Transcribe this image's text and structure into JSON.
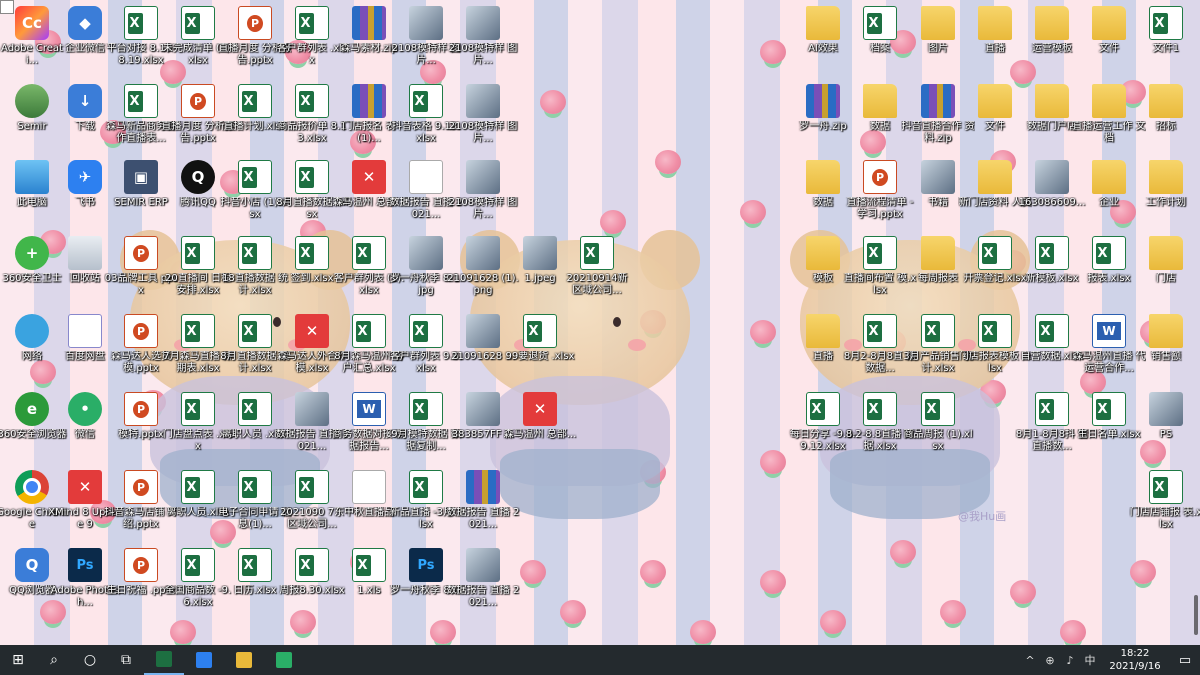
{
  "desktop": {
    "watermark": "@我Hu画",
    "icons": [
      {
        "label": "Adobe Creati...",
        "type": "adobe",
        "glyph": "Cc",
        "col": 0,
        "row": 0
      },
      {
        "label": "Semir",
        "type": "user",
        "glyph": "",
        "col": 0,
        "row": 1
      },
      {
        "label": "此电脑",
        "type": "pc",
        "glyph": "",
        "col": 0,
        "row": 2
      },
      {
        "label": "360安全卫士",
        "type": "360",
        "glyph": "+",
        "col": 0,
        "row": 3
      },
      {
        "label": "网络",
        "type": "net",
        "glyph": "",
        "col": 0,
        "row": 4
      },
      {
        "label": "360安全浏览器",
        "type": "ie",
        "glyph": "e",
        "col": 0,
        "row": 5
      },
      {
        "label": "Google Chrome",
        "type": "chrome",
        "glyph": "",
        "col": 0,
        "row": 6
      },
      {
        "label": "QQ浏览器",
        "type": "app",
        "glyph": "Q",
        "col": 0,
        "row": 7
      },
      {
        "label": "企业微信",
        "type": "app",
        "glyph": "◆",
        "col": 1,
        "row": 0
      },
      {
        "label": "下载",
        "type": "app",
        "glyph": "↓",
        "col": 1,
        "row": 1
      },
      {
        "label": "飞书",
        "type": "feishu",
        "glyph": "✈",
        "col": 1,
        "row": 2
      },
      {
        "label": "回收站",
        "type": "bin",
        "glyph": "",
        "col": 1,
        "row": 3
      },
      {
        "label": "百度网盘",
        "type": "cloud",
        "glyph": "☁",
        "col": 1,
        "row": 4
      },
      {
        "label": "微信",
        "type": "wechat",
        "glyph": "•",
        "col": 1,
        "row": 5
      },
      {
        "label": "XMind 8 Update 9",
        "type": "xmind",
        "glyph": "✕",
        "col": 1,
        "row": 6
      },
      {
        "label": "Adobe Photosh...",
        "type": "ps",
        "glyph": "Ps",
        "col": 1,
        "row": 7
      },
      {
        "label": "平台对接 8.13-8.19.xlsx",
        "type": "excel",
        "glyph": "X",
        "col": 2,
        "row": 0
      },
      {
        "label": "森马新品商务合作直播表...",
        "type": "excel",
        "glyph": "X",
        "col": 2,
        "row": 1
      },
      {
        "label": "SEMIR ERP",
        "type": "erp",
        "glyph": "▣",
        "col": 2,
        "row": 2
      },
      {
        "label": "03品牌工具 pptx",
        "type": "ppt",
        "glyph": "P",
        "col": 2,
        "row": 3
      },
      {
        "label": "森马达人选货 模.pptx",
        "type": "ppt",
        "glyph": "P",
        "col": 2,
        "row": 4
      },
      {
        "label": "模特.pptx",
        "type": "ppt",
        "glyph": "P",
        "col": 2,
        "row": 5
      },
      {
        "label": "抖音森马店铺 介绍.pptx",
        "type": "ppt",
        "glyph": "P",
        "col": 2,
        "row": 6
      },
      {
        "label": "生日祝福 .pptx",
        "type": "ppt",
        "glyph": "P",
        "col": 2,
        "row": 7
      },
      {
        "label": "未完成清单 (1).xlsx",
        "type": "excel",
        "glyph": "X",
        "col": 3,
        "row": 0
      },
      {
        "label": "直播月度 分析报告.pptx",
        "type": "ppt",
        "glyph": "P",
        "col": 3,
        "row": 1
      },
      {
        "label": "腾讯QQ",
        "type": "qq",
        "glyph": "Q",
        "col": 3,
        "row": 2
      },
      {
        "label": "20直播间 日程安排.xlsx",
        "type": "excel",
        "glyph": "X",
        "col": 3,
        "row": 3
      },
      {
        "label": "7月森马直播 排期表.xlsx",
        "type": "excel",
        "glyph": "X",
        "col": 3,
        "row": 4
      },
      {
        "label": "门店盘点表 .xlsx",
        "type": "excel",
        "glyph": "X",
        "col": 3,
        "row": 5
      },
      {
        "label": "离职人员.xlsx",
        "type": "excel",
        "glyph": "X",
        "col": 3,
        "row": 6
      },
      {
        "label": "全国商品数 -9.6.xlsx",
        "type": "excel",
        "glyph": "X",
        "col": 3,
        "row": 7
      },
      {
        "label": "直播月度 分析报告.pptx",
        "type": "ppt",
        "glyph": "P",
        "col": 4,
        "row": 0
      },
      {
        "label": "直播计划.xlsx",
        "type": "excel",
        "glyph": "X",
        "col": 4,
        "row": 1
      },
      {
        "label": "抖音小店 (1).xlsx",
        "type": "excel",
        "glyph": "X",
        "col": 4,
        "row": 2
      },
      {
        "label": "18直播数据 统计.xlsx",
        "type": "excel",
        "glyph": "X",
        "col": 4,
        "row": 3
      },
      {
        "label": "8月直播数据 统计.xlsx",
        "type": "excel",
        "glyph": "X",
        "col": 4,
        "row": 4
      },
      {
        "label": "离职人员 .xlsx",
        "type": "excel",
        "glyph": "X",
        "col": 4,
        "row": 5
      },
      {
        "label": "电子合同申请 信息(1)...",
        "type": "excel",
        "glyph": "X",
        "col": 4,
        "row": 6
      },
      {
        "label": "日历.xlsx",
        "type": "excel",
        "glyph": "X",
        "col": 4,
        "row": 7
      },
      {
        "label": "客户群列表 .xlsx",
        "type": "excel",
        "glyph": "X",
        "col": 5,
        "row": 0
      },
      {
        "label": "商品报价单 8.13.xlsx",
        "type": "excel",
        "glyph": "X",
        "col": 5,
        "row": 1
      },
      {
        "label": "8月直播数据 .xlsx",
        "type": "excel",
        "glyph": "X",
        "col": 5,
        "row": 2
      },
      {
        "label": "签到.xlsx",
        "type": "excel",
        "glyph": "X",
        "col": 5,
        "row": 3
      },
      {
        "label": "森马达人外合作 模.xlsx",
        "type": "xmind",
        "glyph": "✕",
        "col": 5,
        "row": 4
      },
      {
        "label": "数据报告 直播 2021...",
        "type": "img",
        "glyph": "",
        "col": 5,
        "row": 5
      },
      {
        "label": "2021090 7东 区域公司...",
        "type": "excel",
        "glyph": "X",
        "col": 5,
        "row": 6
      },
      {
        "label": "周报8.30.xlsx",
        "type": "excel",
        "glyph": "X",
        "col": 5,
        "row": 7
      },
      {
        "label": "森马素材.zip",
        "type": "zip",
        "glyph": "",
        "col": 6,
        "row": 0
      },
      {
        "label": "门店报名 表(1)...",
        "type": "zip",
        "glyph": "",
        "col": 6,
        "row": 1
      },
      {
        "label": "森马温州 总部...",
        "type": "xmind",
        "glyph": "✕",
        "col": 6,
        "row": 2
      },
      {
        "label": "客户群列表 (1).xlsx",
        "type": "excel",
        "glyph": "X",
        "col": 6,
        "row": 3
      },
      {
        "label": "8月森马温州 客户汇总.xlsx",
        "type": "excel",
        "glyph": "X",
        "col": 6,
        "row": 4
      },
      {
        "label": "商务数据对接 数据报告...",
        "type": "word",
        "glyph": "W",
        "col": 6,
        "row": 5
      },
      {
        "label": "中秋直播品",
        "type": "doc",
        "glyph": "",
        "col": 6,
        "row": 6
      },
      {
        "label": "1.xls",
        "type": "excel",
        "glyph": "X",
        "col": 6,
        "row": 7
      },
      {
        "label": "2108模特样 图片...",
        "type": "img",
        "glyph": "",
        "col": 7,
        "row": 0
      },
      {
        "label": "抖音表格 9.13.xlsx",
        "type": "excel",
        "glyph": "X",
        "col": 7,
        "row": 1
      },
      {
        "label": "数据报告 直播 2021...",
        "type": "doc",
        "glyph": "",
        "col": 7,
        "row": 2
      },
      {
        "label": "罗一舟秋季 8-1.jpg",
        "type": "img",
        "glyph": "",
        "col": 7,
        "row": 3
      },
      {
        "label": "客户群列表 9.6.xlsx",
        "type": "excel",
        "glyph": "X",
        "col": 7,
        "row": 4
      },
      {
        "label": "9月模特数据 数据复制...",
        "type": "excel",
        "glyph": "X",
        "col": 7,
        "row": 5
      },
      {
        "label": "新品直播 -3月.xlsx",
        "type": "excel",
        "glyph": "X",
        "col": 7,
        "row": 6
      },
      {
        "label": "罗一舟秋季 8.ai",
        "type": "ps",
        "glyph": "Ps",
        "col": 7,
        "row": 7
      },
      {
        "label": "2108模特样 图片...",
        "type": "img",
        "glyph": "",
        "col": 8,
        "row": 0
      },
      {
        "label": "2108模特样 图片...",
        "type": "img",
        "glyph": "",
        "col": 8,
        "row": 1
      },
      {
        "label": "2108模特样 图片...",
        "type": "img",
        "glyph": "",
        "col": 8,
        "row": 2
      },
      {
        "label": "21091628 (1).png",
        "type": "img",
        "glyph": "",
        "col": 8,
        "row": 3
      },
      {
        "label": "21091628 ...",
        "type": "img",
        "glyph": "",
        "col": 8,
        "row": 4
      },
      {
        "label": "383857FF ...",
        "type": "img",
        "glyph": "",
        "col": 8,
        "row": 5
      },
      {
        "label": "数据报告 直播 2021...",
        "type": "zip",
        "glyph": "",
        "col": 8,
        "row": 6
      },
      {
        "label": "数据报告 直播 2021...",
        "type": "img",
        "glyph": "",
        "col": 8,
        "row": 7
      },
      {
        "label": "1.jpeg",
        "type": "img",
        "glyph": "",
        "col": 9,
        "row": 3
      },
      {
        "label": "99要退货 .xlsx",
        "type": "excel",
        "glyph": "X",
        "col": 9,
        "row": 4
      },
      {
        "label": "森马温州 总部...",
        "type": "xmind",
        "glyph": "✕",
        "col": 9,
        "row": 5
      },
      {
        "label": "20210914新 区域公司...",
        "type": "excel",
        "glyph": "X",
        "col": 10,
        "row": 3
      },
      {
        "label": "AI效果",
        "type": "folder",
        "glyph": "",
        "col": 12,
        "row": 0
      },
      {
        "label": "罗一舟.zip",
        "type": "zip",
        "glyph": "",
        "col": 12,
        "row": 1
      },
      {
        "label": "数据",
        "type": "folder",
        "glyph": "",
        "col": 12,
        "row": 2
      },
      {
        "label": "模板",
        "type": "folder",
        "glyph": "",
        "col": 12,
        "row": 3
      },
      {
        "label": "直播",
        "type": "folder",
        "glyph": "",
        "col": 12,
        "row": 4
      },
      {
        "label": "每日分享 -9.6-9.12.xlsx",
        "type": "excel",
        "glyph": "X",
        "col": 12,
        "row": 5
      },
      {
        "label": "档案",
        "type": "excel",
        "glyph": "X",
        "col": 13,
        "row": 0
      },
      {
        "label": "数据",
        "type": "folder",
        "glyph": "",
        "col": 13,
        "row": 1
      },
      {
        "label": "直播流程清单 -学习.pptx",
        "type": "ppt",
        "glyph": "P",
        "col": 13,
        "row": 2
      },
      {
        "label": "直播间布置 模.xlsx",
        "type": "excel",
        "glyph": "X",
        "col": 13,
        "row": 3
      },
      {
        "label": "8月2-8月8直 播数据...",
        "type": "excel",
        "glyph": "X",
        "col": 13,
        "row": 4
      },
      {
        "label": "8.2-8.8直播 数据.xlsx",
        "type": "excel",
        "glyph": "X",
        "col": 13,
        "row": 5
      },
      {
        "label": "图片",
        "type": "folder",
        "glyph": "",
        "col": 14,
        "row": 0
      },
      {
        "label": "抖音直播合作 资料.zip",
        "type": "zip",
        "glyph": "",
        "col": 14,
        "row": 1
      },
      {
        "label": "书籍",
        "type": "img",
        "glyph": "",
        "col": 14,
        "row": 2
      },
      {
        "label": "每周报表",
        "type": "folder",
        "glyph": "",
        "col": 14,
        "row": 3
      },
      {
        "label": "3月产品销售 统计.xlsx",
        "type": "excel",
        "glyph": "X",
        "col": 14,
        "row": 4
      },
      {
        "label": "商品周报 (1).xlsx",
        "type": "excel",
        "glyph": "X",
        "col": 14,
        "row": 5
      },
      {
        "label": "直播",
        "type": "folder",
        "glyph": "",
        "col": 15,
        "row": 0
      },
      {
        "label": "文件",
        "type": "folder",
        "glyph": "",
        "col": 15,
        "row": 1
      },
      {
        "label": "新门店资料 人员",
        "type": "folder",
        "glyph": "",
        "col": 15,
        "row": 2
      },
      {
        "label": "开票登记.xlsx",
        "type": "excel",
        "glyph": "X",
        "col": 15,
        "row": 3
      },
      {
        "label": "门店报表模板 .xlsx",
        "type": "excel",
        "glyph": "X",
        "col": 15,
        "row": 4
      },
      {
        "label": "运营模板",
        "type": "folder",
        "glyph": "",
        "col": 16,
        "row": 0
      },
      {
        "label": "数据门户店",
        "type": "folder",
        "glyph": "",
        "col": 16,
        "row": 1
      },
      {
        "label": "163086609...",
        "type": "img",
        "glyph": "",
        "col": 16,
        "row": 2
      },
      {
        "label": "新模板.xlsx",
        "type": "excel",
        "glyph": "X",
        "col": 16,
        "row": 3
      },
      {
        "label": "自营数据.xlsx",
        "type": "excel",
        "glyph": "X",
        "col": 16,
        "row": 4
      },
      {
        "label": "8月1-8月8抖 音直播数...",
        "type": "excel",
        "glyph": "X",
        "col": 16,
        "row": 5
      },
      {
        "label": "文件",
        "type": "folder",
        "glyph": "",
        "col": 17,
        "row": 0
      },
      {
        "label": "直播运营工作 文档",
        "type": "folder",
        "glyph": "",
        "col": 17,
        "row": 1
      },
      {
        "label": "企业",
        "type": "folder",
        "glyph": "",
        "col": 17,
        "row": 2
      },
      {
        "label": "报表.xlsx",
        "type": "excel",
        "glyph": "X",
        "col": 17,
        "row": 3
      },
      {
        "label": "森马温州直播 代运营合作...",
        "type": "word",
        "glyph": "W",
        "col": 17,
        "row": 4
      },
      {
        "label": "生日名单.xlsx",
        "type": "excel",
        "glyph": "X",
        "col": 17,
        "row": 5
      },
      {
        "label": "文件1",
        "type": "excel",
        "glyph": "X",
        "col": 18,
        "row": 0
      },
      {
        "label": "招标",
        "type": "folder",
        "glyph": "",
        "col": 18,
        "row": 1
      },
      {
        "label": "工作计划",
        "type": "folder",
        "glyph": "",
        "col": 18,
        "row": 2
      },
      {
        "label": "门店",
        "type": "folder",
        "glyph": "",
        "col": 18,
        "row": 3
      },
      {
        "label": "销售额",
        "type": "folder",
        "glyph": "",
        "col": 18,
        "row": 4
      },
      {
        "label": "PS",
        "type": "img",
        "glyph": "",
        "col": 18,
        "row": 5
      },
      {
        "label": "门店店铺报 表.xlsx",
        "type": "excel",
        "glyph": "X",
        "col": 18,
        "row": 6
      }
    ]
  },
  "taskbar": {
    "start_glyph": "⊞",
    "search_glyph": "⌕",
    "cortana_glyph": "○",
    "taskview_glyph": "⧉",
    "apps": [
      {
        "name": "excel-taskbar-app",
        "color": "#1d6f41",
        "active": true
      },
      {
        "name": "feishu-taskbar-app",
        "color": "#2d80f0",
        "active": false
      },
      {
        "name": "explorer-taskbar-app",
        "color": "#e9b93a",
        "active": false
      },
      {
        "name": "wechat-taskbar-app",
        "color": "#2aae67",
        "active": false
      }
    ],
    "tray": {
      "overflow": "^",
      "network": "⊕",
      "volume": "♪",
      "ime": "中",
      "time": "18:22",
      "date": "2021/9/16",
      "notification": "▭"
    }
  }
}
